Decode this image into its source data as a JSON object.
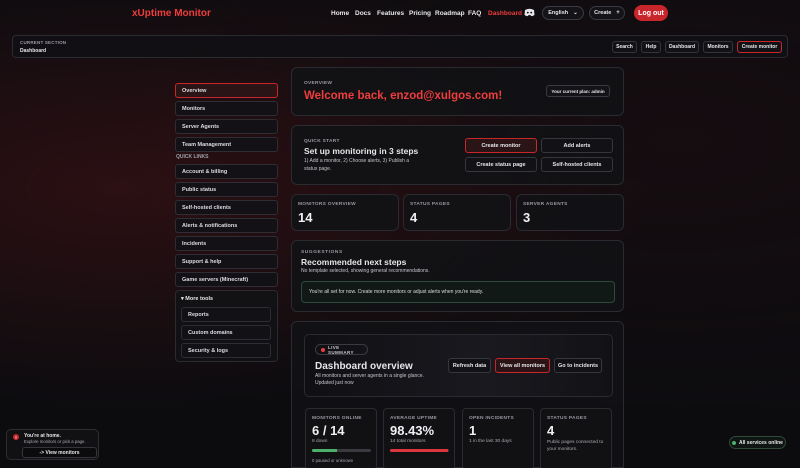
{
  "nav": {
    "brand": "xUptime Monitor",
    "links": [
      "Home",
      "Docs",
      "Features",
      "Pricing",
      "Roadmap",
      "FAQ",
      "Dashboard"
    ],
    "language": "English",
    "create": "Create",
    "create_icon": "plus-icon",
    "logout": "Log out"
  },
  "section": {
    "label": "CURRENT SECTION",
    "value": "Dashboard",
    "buttons": [
      "Search",
      "Help",
      "Dashboard",
      "Monitors",
      "Create monitor"
    ]
  },
  "sidebar": {
    "items": [
      "Overview",
      "Monitors",
      "Server Agents",
      "Team Management"
    ],
    "quick_links_label": "QUICK LINKS",
    "quick_links": [
      "Account & billing",
      "Public status",
      "Self-hosted clients",
      "Alerts & notifications",
      "Incidents",
      "Support & help",
      "Game servers (Minecraft)"
    ],
    "more_tools_label": "▾ More tools",
    "more_tools": [
      "Reports",
      "Custom domains",
      "Security & logs"
    ]
  },
  "overview": {
    "label": "OVERVIEW",
    "welcome": "Welcome back, enzod@xulgos.com!",
    "plan_badge": "Your current plan: admin"
  },
  "quickstart": {
    "label": "QUICK START",
    "title": "Set up monitoring in 3 steps",
    "desc": "1) Add a monitor, 2) Choose alerts, 3) Publish a status page.",
    "buttons": [
      "Create monitor",
      "Add alerts",
      "Create status page",
      "Self-hosted clients"
    ]
  },
  "stats": [
    {
      "label": "MONITORS OVERVIEW",
      "value": "14"
    },
    {
      "label": "STATUS PAGES",
      "value": "4"
    },
    {
      "label": "SERVER AGENTS",
      "value": "3"
    }
  ],
  "suggestions": {
    "label": "SUGGESTIONS",
    "title": "Recommended next steps",
    "desc": "No template selected, showing general recommendations.",
    "notice": "You're all set for now. Create more monitors or adjust alerts when you're ready."
  },
  "live": {
    "badge": "LIVE SUMMARY",
    "title": "Dashboard overview",
    "desc": "All monitors and server agents in a single glance.",
    "updated": "Updated just now",
    "buttons": [
      "Refresh data",
      "View all monitors",
      "Go to incidents"
    ]
  },
  "metrics": [
    {
      "label": "MONITORS ONLINE",
      "value": "6 / 14",
      "sub": "8 down",
      "extra": "0 paused or unknown",
      "bar_fill": 0.43,
      "bar_color": "#4caf6a"
    },
    {
      "label": "AVERAGE UPTIME",
      "value": "98.43%",
      "sub": "14 total monitors",
      "bar_fill": 0.9843,
      "bar_color": "#d9363e"
    },
    {
      "label": "OPEN INCIDENTS",
      "value": "1",
      "sub": "1 in the last 30 days"
    },
    {
      "label": "STATUS PAGES",
      "value": "4",
      "sub": "Public pages connected to your monitors."
    }
  ],
  "toast": {
    "title": "You're at home.",
    "desc": "Explore monitors or pick a page.",
    "button": "-> View monitors",
    "icon": "alert-icon"
  },
  "services": {
    "text": "All services online",
    "color": "#4caf6a"
  }
}
